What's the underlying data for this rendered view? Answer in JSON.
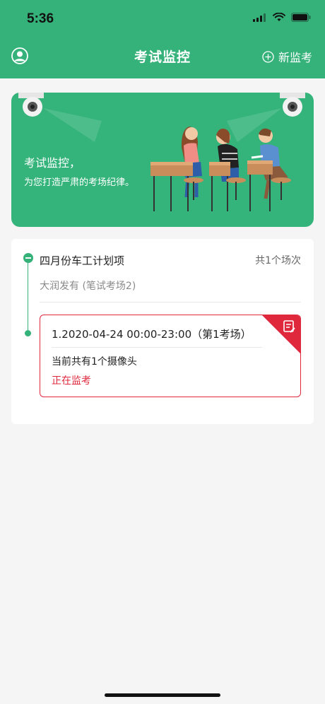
{
  "status_bar": {
    "time": "5:36"
  },
  "nav": {
    "title": "考试监控",
    "new_label": "新监考"
  },
  "banner": {
    "title": "考试监控，",
    "subtitle": "为您打造严肃的考场纪律。"
  },
  "plan": {
    "title": "四月份车工计划项",
    "count": "共1个场次",
    "subtitle": "大润发有 (笔试考场2)"
  },
  "session": {
    "title": "1.2020-04-24 00:00-23:00（第1考场）",
    "camera": "当前共有1个摄像头",
    "status": "正在监考"
  },
  "colors": {
    "primary": "#35b27a",
    "alert": "#e0283d"
  }
}
